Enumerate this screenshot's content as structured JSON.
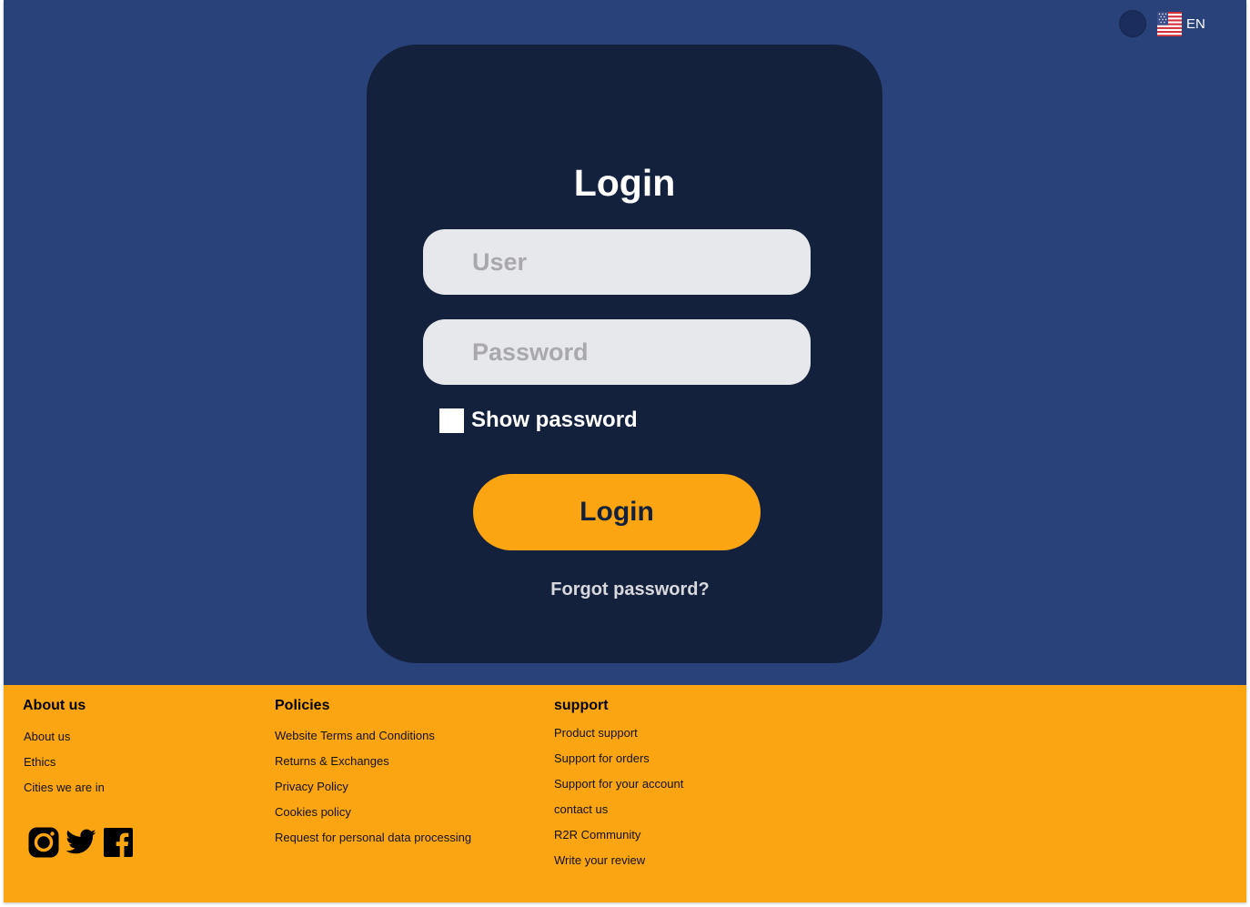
{
  "header": {
    "theme_toggle": "dark-mode-toggle",
    "language": {
      "code": "EN",
      "flag_icon": "us-flag-icon"
    }
  },
  "login_card": {
    "title": "Login",
    "user_placeholder": "User",
    "password_placeholder": "Password",
    "show_password_label": "Show password",
    "show_password_checked": false,
    "submit_label": "Login",
    "forgot_label": "Forgot password?"
  },
  "footer": {
    "about": {
      "heading": "About us",
      "links": [
        "About us",
        "Ethics",
        "Cities we are in"
      ]
    },
    "policies": {
      "heading": "Policies",
      "links": [
        "Website Terms and Conditions",
        "Returns & Exchanges",
        "Privacy Policy",
        "Cookies policy",
        "Request for personal data processing"
      ]
    },
    "support": {
      "heading": "support",
      "links": [
        "Product support",
        "Support for orders",
        "Support for your account",
        "contact us",
        "R2R Community",
        "Write your review"
      ]
    },
    "social_icons": [
      "instagram-icon",
      "twitter-icon",
      "facebook-icon"
    ]
  },
  "colors": {
    "background": "#29427a",
    "card": "#14213d",
    "accent": "#fca512",
    "input": "#e7e8ec"
  }
}
